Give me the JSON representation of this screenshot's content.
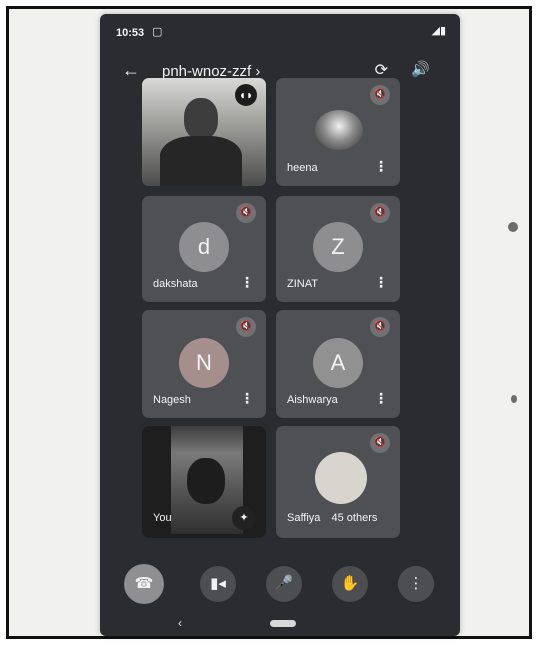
{
  "status_bar": {
    "time": "10:53",
    "camera_glyph": "▢",
    "system_glyphs": "◢▮"
  },
  "header": {
    "back_glyph": "←",
    "meeting_code": "pnh-wnoz-zzf ›",
    "switch_camera_glyph": "⟳",
    "speaker_glyph": "🔊"
  },
  "tiles": [
    {
      "name": "",
      "type": "video",
      "speaking": true
    },
    {
      "name": "heena",
      "type": "photo",
      "muted": true
    },
    {
      "name": "dakshata",
      "initial": "d",
      "avatar_color": "#8e8e90",
      "muted": true
    },
    {
      "name": "ZINAT",
      "initial": "Z",
      "avatar_color": "#8e8e90",
      "muted": true
    },
    {
      "name": "Nagesh",
      "initial": "N",
      "avatar_color": "#a58f8d",
      "muted": true
    },
    {
      "name": "Aishwarya",
      "initial": "A",
      "avatar_color": "#919192",
      "muted": true
    },
    {
      "name": "You",
      "type": "self-video"
    },
    {
      "name": "Saffiya",
      "extra": "45 others",
      "muted": true
    }
  ],
  "icons": {
    "mute": "🔇",
    "menu": "⋮",
    "speaking": "◖◗",
    "effects": "✦"
  },
  "controls": {
    "end_call": "☎",
    "camera": "▮◂",
    "microphone": "🎤",
    "raise_hand": "✋",
    "more": "⋮"
  },
  "nav": {
    "back": "‹"
  }
}
